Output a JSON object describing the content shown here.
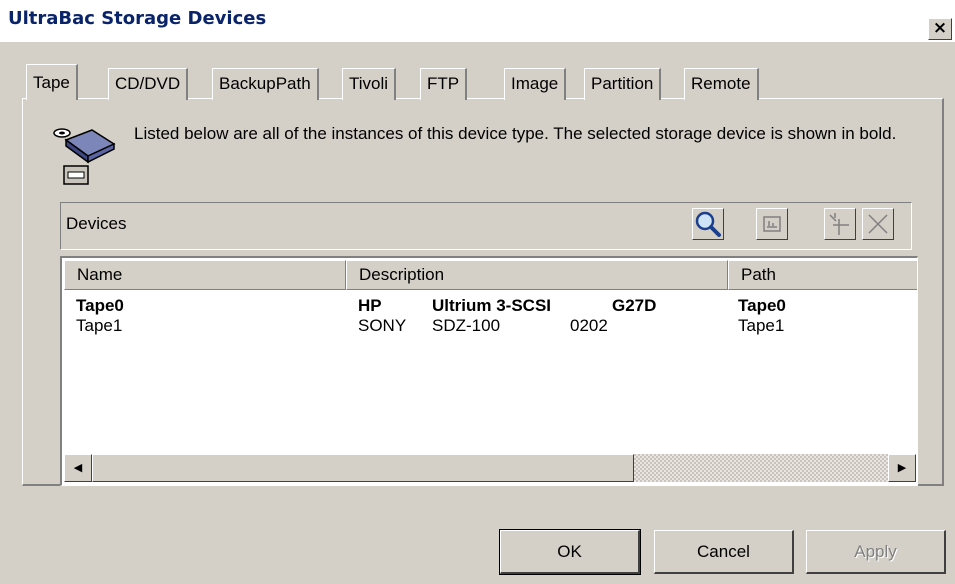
{
  "window": {
    "title": "UltraBac Storage Devices",
    "close_label": "×"
  },
  "tabs": [
    {
      "label": "Tape",
      "active": true
    },
    {
      "label": "CD/DVD"
    },
    {
      "label": "BackupPath"
    },
    {
      "label": "Tivoli"
    },
    {
      "label": "FTP"
    },
    {
      "label": "Image"
    },
    {
      "label": "Partition"
    },
    {
      "label": "Remote"
    }
  ],
  "description": {
    "icon": "tape-drive-icon",
    "text": "Listed below are all of the instances of this device type. The selected storage device is shown in bold."
  },
  "toolbar": {
    "label": "Devices",
    "buttons": [
      "search-icon",
      "properties-icon",
      "add-device-icon",
      "delete-icon"
    ]
  },
  "devices": {
    "columns": [
      "Name",
      "Description",
      "Path"
    ],
    "rows": [
      {
        "name": "Tape0",
        "vendor": "HP",
        "model": "Ultrium 3-SCSI",
        "revision": "G27D",
        "path": "Tape0",
        "selected": true
      },
      {
        "name": "Tape1",
        "vendor": "SONY",
        "model": "SDZ-100",
        "revision": "0202",
        "path": "Tape1",
        "selected": false
      }
    ]
  },
  "buttons": {
    "ok": "OK",
    "cancel": "Cancel",
    "apply": "Apply"
  }
}
